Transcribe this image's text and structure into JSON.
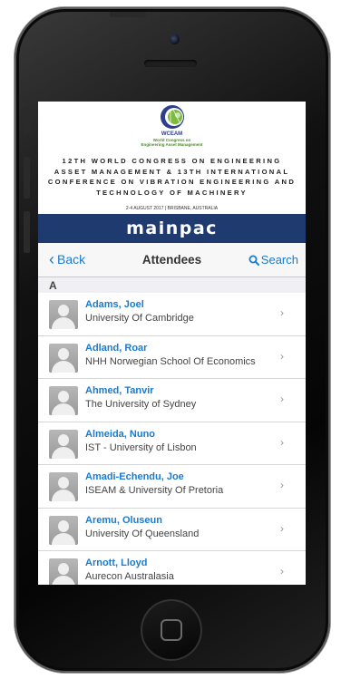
{
  "banner": {
    "logo_name": "WCEAM",
    "logo_subtitle_1": "World Congress on",
    "logo_subtitle_2": "Engineering Asset Management",
    "title_line_1": "12TH WORLD CONGRESS ON ENGINEERING",
    "title_line_2": "ASSET MANAGEMENT & 13TH INTERNATIONAL",
    "title_line_3": "CONFERENCE ON VIBRATION ENGINEERING AND",
    "title_line_4": "TECHNOLOGY OF MACHINERY",
    "date_location": "2-4 AUGUST 2017 | BRISBANE, AUSTRALIA"
  },
  "sponsor": {
    "name": "mainpac"
  },
  "navbar": {
    "back_label": "Back",
    "title": "Attendees",
    "search_label": "Search"
  },
  "section": {
    "letter": "A"
  },
  "attendees": [
    {
      "name": "Adams, Joel",
      "organization": "University Of Cambridge"
    },
    {
      "name": "Adland, Roar",
      "organization": "NHH Norwegian School Of Economics"
    },
    {
      "name": "Ahmed, Tanvir",
      "organization": "The University of Sydney"
    },
    {
      "name": "Almeida, Nuno",
      "organization": "IST - University of Lisbon"
    },
    {
      "name": "Amadi-Echendu, Joe",
      "organization": "ISEAM & University Of Pretoria"
    },
    {
      "name": "Aremu, Oluseun",
      "organization": "University Of Queensland"
    },
    {
      "name": "Arnott, Lloyd",
      "organization": "Aurecon Australasia"
    }
  ],
  "icons": {
    "back": "chevron-left-icon",
    "search": "search-icon",
    "row": "chevron-right-icon",
    "avatar": "person-placeholder-icon"
  },
  "colors": {
    "accent": "#1a7bd1",
    "sponsor_bar": "#1e3a6e",
    "section_bg": "#efeff4"
  }
}
